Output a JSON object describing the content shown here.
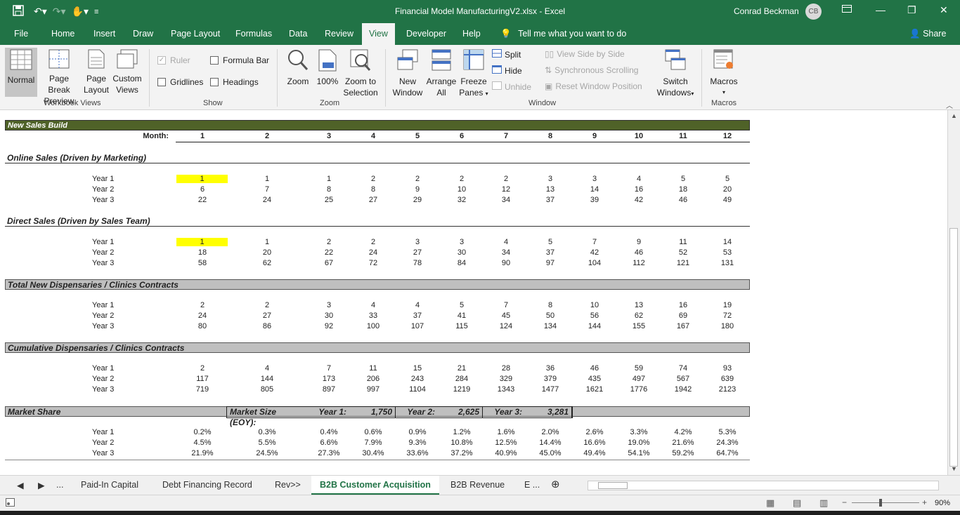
{
  "window": {
    "title": "Financial Model ManufacturingV2.xlsx  -  Excel",
    "user": "Conrad Beckman",
    "user_initials": "CB"
  },
  "ribbon_tabs": [
    "File",
    "Home",
    "Insert",
    "Draw",
    "Page Layout",
    "Formulas",
    "Data",
    "Review",
    "View",
    "Developer",
    "Help"
  ],
  "active_tab": "View",
  "tell_me": "Tell me what you want to do",
  "share": "Share",
  "ribbon": {
    "workbook_views": {
      "label": "Workbook Views",
      "normal": "Normal",
      "page_break_1": "Page Break",
      "page_break_2": "Preview",
      "page_layout_1": "Page",
      "page_layout_2": "Layout",
      "custom_1": "Custom",
      "custom_2": "Views"
    },
    "show": {
      "label": "Show",
      "ruler": "Ruler",
      "formula_bar": "Formula Bar",
      "gridlines": "Gridlines",
      "headings": "Headings"
    },
    "zoom": {
      "label": "Zoom",
      "zoom": "Zoom",
      "hundred": "100%",
      "sel_1": "Zoom to",
      "sel_2": "Selection"
    },
    "window": {
      "label": "Window",
      "new_1": "New",
      "new_2": "Window",
      "arrange_1": "Arrange",
      "arrange_2": "All",
      "freeze_1": "Freeze",
      "freeze_2": "Panes",
      "split": "Split",
      "hide": "Hide",
      "unhide": "Unhide",
      "side_by_side": "View Side by Side",
      "sync_scroll": "Synchronous Scrolling",
      "reset_pos": "Reset Window Position",
      "switch_1": "Switch",
      "switch_2": "Windows"
    },
    "macros": {
      "label": "Macros",
      "btn": "Macros"
    }
  },
  "sheet": {
    "header_title": "New Sales Build",
    "month_label": "Month:",
    "months": [
      "1",
      "2",
      "3",
      "4",
      "5",
      "6",
      "7",
      "8",
      "9",
      "10",
      "11",
      "12"
    ],
    "sections": [
      {
        "title": "Online Sales (Driven by Marketing)",
        "rows": [
          {
            "label": "Year 1",
            "values": [
              "1",
              "1",
              "1",
              "2",
              "2",
              "2",
              "2",
              "3",
              "3",
              "4",
              "5",
              "5"
            ]
          },
          {
            "label": "Year 2",
            "values": [
              "6",
              "7",
              "8",
              "8",
              "9",
              "10",
              "12",
              "13",
              "14",
              "16",
              "18",
              "20"
            ]
          },
          {
            "label": "Year 3",
            "values": [
              "22",
              "24",
              "25",
              "27",
              "29",
              "32",
              "34",
              "37",
              "39",
              "42",
              "46",
              "49"
            ]
          }
        ]
      },
      {
        "title": "Direct Sales (Driven by Sales Team)",
        "rows": [
          {
            "label": "Year 1",
            "values": [
              "1",
              "1",
              "2",
              "2",
              "3",
              "3",
              "4",
              "5",
              "7",
              "9",
              "11",
              "14"
            ]
          },
          {
            "label": "Year 2",
            "values": [
              "18",
              "20",
              "22",
              "24",
              "27",
              "30",
              "34",
              "37",
              "42",
              "46",
              "52",
              "53"
            ]
          },
          {
            "label": "Year 3",
            "values": [
              "58",
              "62",
              "67",
              "72",
              "78",
              "84",
              "90",
              "97",
              "104",
              "112",
              "121",
              "131"
            ]
          }
        ]
      },
      {
        "title": "Total New Dispensaries / Clinics Contracts",
        "rows": [
          {
            "label": "Year 1",
            "values": [
              "2",
              "2",
              "3",
              "4",
              "4",
              "5",
              "7",
              "8",
              "10",
              "13",
              "16",
              "19"
            ]
          },
          {
            "label": "Year 2",
            "values": [
              "24",
              "27",
              "30",
              "33",
              "37",
              "41",
              "45",
              "50",
              "56",
              "62",
              "69",
              "72"
            ]
          },
          {
            "label": "Year 3",
            "values": [
              "80",
              "86",
              "92",
              "100",
              "107",
              "115",
              "124",
              "134",
              "144",
              "155",
              "167",
              "180"
            ]
          }
        ]
      },
      {
        "title": "Cumulative Dispensaries / Clinics Contracts",
        "rows": [
          {
            "label": "Year 1",
            "values": [
              "2",
              "4",
              "7",
              "11",
              "15",
              "21",
              "28",
              "36",
              "46",
              "59",
              "74",
              "93"
            ]
          },
          {
            "label": "Year 2",
            "values": [
              "117",
              "144",
              "173",
              "206",
              "243",
              "284",
              "329",
              "379",
              "435",
              "497",
              "567",
              "639"
            ]
          },
          {
            "label": "Year 3",
            "values": [
              "719",
              "805",
              "897",
              "997",
              "1104",
              "1219",
              "1343",
              "1477",
              "1621",
              "1776",
              "1942",
              "2123"
            ]
          }
        ]
      },
      {
        "title": "Market Share",
        "market_size_label": "Market Size (EOY):",
        "y1_label": "Year 1:",
        "y1_value": "1,750",
        "y2_label": "Year 2:",
        "y2_value": "2,625",
        "y3_label": "Year 3:",
        "y3_value": "3,281",
        "rows": [
          {
            "label": "Year 1",
            "values": [
              "0.2%",
              "0.3%",
              "0.4%",
              "0.6%",
              "0.9%",
              "1.2%",
              "1.6%",
              "2.0%",
              "2.6%",
              "3.3%",
              "4.2%",
              "5.3%"
            ]
          },
          {
            "label": "Year 2",
            "values": [
              "4.5%",
              "5.5%",
              "6.6%",
              "7.9%",
              "9.3%",
              "10.8%",
              "12.5%",
              "14.4%",
              "16.6%",
              "19.0%",
              "21.6%",
              "24.3%"
            ]
          },
          {
            "label": "Year 3",
            "values": [
              "21.9%",
              "24.5%",
              "27.3%",
              "30.4%",
              "33.6%",
              "37.2%",
              "40.9%",
              "45.0%",
              "49.4%",
              "54.1%",
              "59.2%",
              "64.7%"
            ]
          }
        ]
      }
    ]
  },
  "sheet_tabs": [
    "...",
    "Paid-In Capital",
    "Debt Financing Record",
    "Rev>>",
    "B2B Customer Acquisition",
    "B2B Revenue",
    "E ..."
  ],
  "active_sheet": "B2B Customer Acquisition",
  "zoom_level": "90%",
  "colors": {
    "excel_green": "#217346",
    "highlight": "#ffff00",
    "header_green": "#4f6228",
    "header_gray": "#bfbfbf"
  }
}
